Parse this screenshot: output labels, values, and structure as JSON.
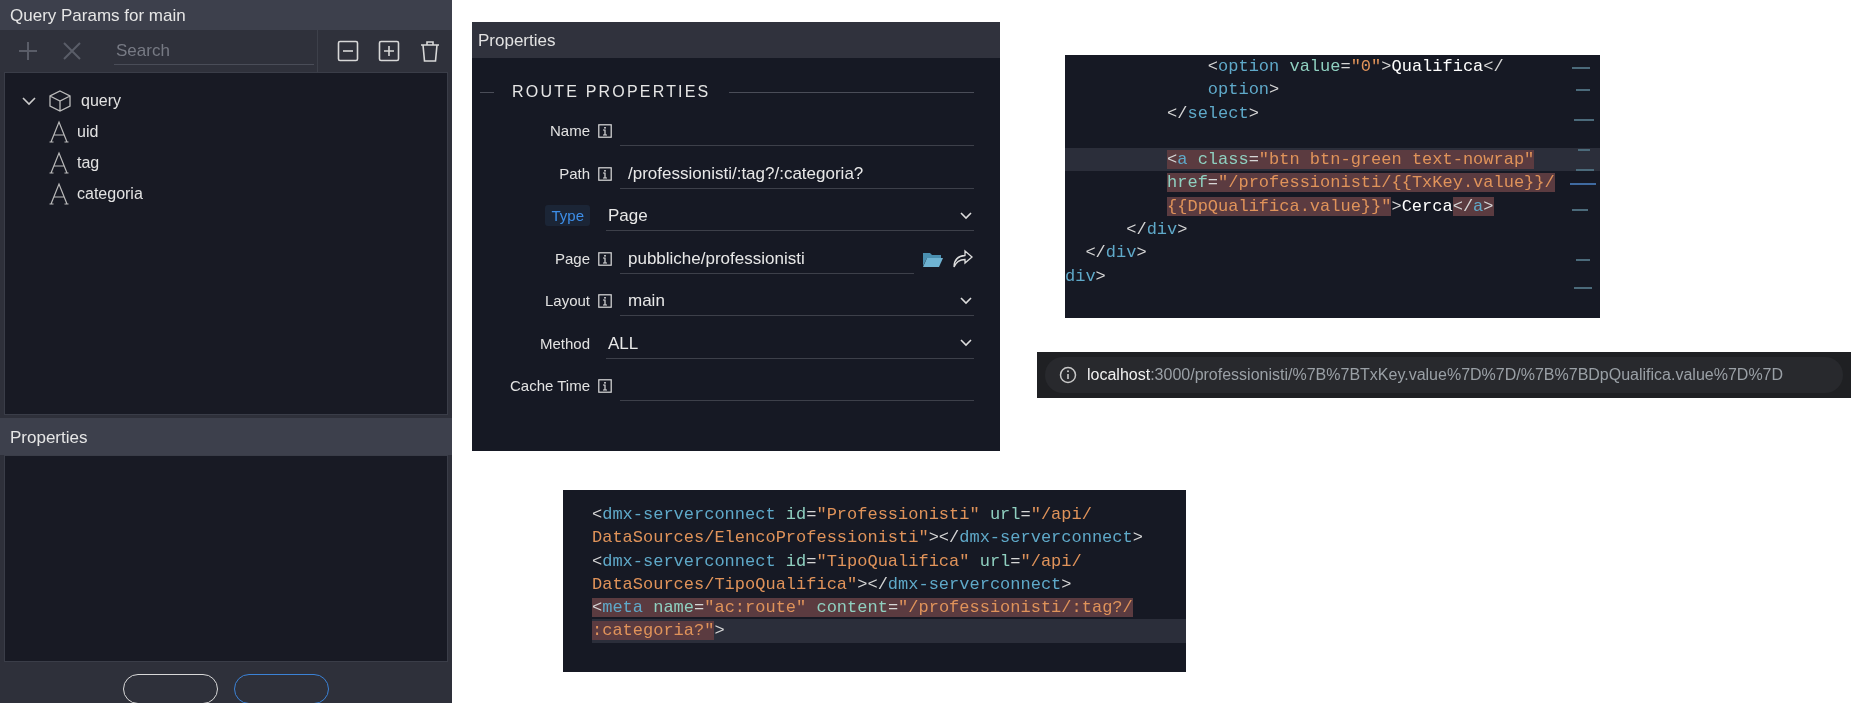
{
  "query_params_panel": {
    "title": "Query Params for main",
    "toolbar": [
      {
        "kind": "add",
        "disabled": true
      },
      {
        "kind": "remove",
        "disabled": true
      },
      {
        "kind": "collapse",
        "disabled": false
      },
      {
        "kind": "expand",
        "disabled": false
      },
      {
        "kind": "delete",
        "disabled": false
      }
    ],
    "search": {
      "placeholder": "Search"
    },
    "tree": [
      {
        "label": "query",
        "kind": "object",
        "expanded": true,
        "children": [
          {
            "label": "uid",
            "kind": "text"
          },
          {
            "label": "tag",
            "kind": "text"
          },
          {
            "label": "categoria",
            "kind": "text"
          }
        ]
      }
    ],
    "properties_title": "Properties",
    "footer_buttons": [
      {
        "kind": "plain"
      },
      {
        "kind": "primary"
      }
    ]
  },
  "route_panel": {
    "title": "Properties",
    "section": "ROUTE PROPERTIES",
    "rows": [
      {
        "label": "Name",
        "kind": "input",
        "info": true,
        "highlighted": false
      },
      {
        "label": "Path",
        "kind": "input",
        "info": true,
        "value": "/professionisti/:tag?/:categoria?",
        "highlighted": false
      },
      {
        "label": "Type",
        "kind": "select",
        "info": false,
        "value": "Page",
        "highlighted": true
      },
      {
        "label": "Page",
        "kind": "page",
        "info": true,
        "value": "pubbliche/professionisti",
        "highlighted": false
      },
      {
        "label": "Layout",
        "kind": "select",
        "info": true,
        "value": "main",
        "highlighted": false
      },
      {
        "label": "Method",
        "kind": "select",
        "info": false,
        "value": "ALL",
        "highlighted": false
      },
      {
        "label": "Cache Time",
        "kind": "input",
        "info": true,
        "highlighted": false
      }
    ]
  },
  "code_top": {
    "lines": [
      {
        "current": false,
        "tokens": [
          {
            "kind": "punct",
            "text": "              <",
            "marked": false
          },
          {
            "kind": "tag",
            "text": "option",
            "marked": false
          },
          {
            "kind": "attr",
            "text": " value",
            "marked": false
          },
          {
            "kind": "punct",
            "text": "=",
            "marked": false
          },
          {
            "kind": "str",
            "text": "\"0\"",
            "marked": false
          },
          {
            "kind": "punct",
            "text": ">",
            "marked": false
          },
          {
            "kind": "text",
            "text": "Qualifica",
            "marked": false
          },
          {
            "kind": "punct",
            "text": "</",
            "marked": false
          }
        ]
      },
      {
        "current": false,
        "tokens": [
          {
            "kind": "tag",
            "text": "              option",
            "marked": false
          },
          {
            "kind": "punct",
            "text": ">",
            "marked": false
          }
        ]
      },
      {
        "current": false,
        "tokens": [
          {
            "kind": "punct",
            "text": "          </",
            "marked": false
          },
          {
            "kind": "tag",
            "text": "select",
            "marked": false
          },
          {
            "kind": "punct",
            "text": ">",
            "marked": false
          }
        ]
      },
      {
        "current": false
      },
      {
        "current": true,
        "tokens": [
          {
            "kind": "punct",
            "text": "          <",
            "marked": true
          },
          {
            "kind": "tag",
            "text": "a",
            "marked": true
          },
          {
            "kind": "attr",
            "text": " class",
            "marked": true
          },
          {
            "kind": "punct",
            "text": "=",
            "marked": true
          },
          {
            "kind": "str",
            "text": "\"btn btn-green text-nowrap\"",
            "marked": true
          }
        ]
      },
      {
        "current": false,
        "tokens": [
          {
            "kind": "attr",
            "text": "          href",
            "marked": true
          },
          {
            "kind": "punct",
            "text": "=",
            "marked": true
          },
          {
            "kind": "str",
            "text": "\"/professionisti/{{TxKey.value}}/",
            "marked": true
          }
        ]
      },
      {
        "current": false,
        "tokens": [
          {
            "kind": "str",
            "text": "          {{DpQualifica.value}}\"",
            "marked": true
          },
          {
            "kind": "punct",
            "text": ">",
            "marked": false
          },
          {
            "kind": "text",
            "text": "Cerca",
            "marked": false
          },
          {
            "kind": "punct",
            "text": "</",
            "marked": true
          },
          {
            "kind": "tag",
            "text": "a",
            "marked": true
          },
          {
            "kind": "punct",
            "text": ">",
            "marked": true
          }
        ]
      },
      {
        "current": false,
        "tokens": [
          {
            "kind": "punct",
            "text": "      </",
            "marked": false
          },
          {
            "kind": "tag",
            "text": "div",
            "marked": false
          },
          {
            "kind": "punct",
            "text": ">",
            "marked": false
          }
        ]
      },
      {
        "current": false,
        "tokens": [
          {
            "kind": "punct",
            "text": "  </",
            "marked": false
          },
          {
            "kind": "tag",
            "text": "div",
            "marked": false
          },
          {
            "kind": "punct",
            "text": ">",
            "marked": false
          }
        ]
      },
      {
        "current": false,
        "tokens": [
          {
            "kind": "tag",
            "text": "div",
            "marked": false
          },
          {
            "kind": "punct",
            "text": ">",
            "marked": false
          }
        ]
      }
    ]
  },
  "address_bar": {
    "host": "localhost",
    "path": ":3000/professionisti/%7B%7BTxKey.value%7D%7D/%7B%7BDpQualifica.value%7D%7D"
  },
  "code_bottom": {
    "lines": [
      {
        "current": false,
        "tokens": [
          {
            "kind": "punct",
            "text": "<",
            "marked": false
          },
          {
            "kind": "tag",
            "text": "dmx-serverconnect",
            "marked": false
          },
          {
            "kind": "attr",
            "text": " id",
            "marked": false
          },
          {
            "kind": "punct",
            "text": "=",
            "marked": false
          },
          {
            "kind": "str",
            "text": "\"Professionisti\"",
            "marked": false
          },
          {
            "kind": "attr",
            "text": " url",
            "marked": false
          },
          {
            "kind": "punct",
            "text": "=",
            "marked": false
          },
          {
            "kind": "str",
            "text": "\"/api/",
            "marked": false
          }
        ]
      },
      {
        "current": false,
        "tokens": [
          {
            "kind": "str",
            "text": "DataSources/ElencoProfessionisti\"",
            "marked": false
          },
          {
            "kind": "punct",
            "text": "></",
            "marked": false
          },
          {
            "kind": "tag",
            "text": "dmx-serverconnect",
            "marked": false
          },
          {
            "kind": "punct",
            "text": ">",
            "marked": false
          }
        ]
      },
      {
        "current": false,
        "tokens": [
          {
            "kind": "punct",
            "text": "<",
            "marked": false
          },
          {
            "kind": "tag",
            "text": "dmx-serverconnect",
            "marked": false
          },
          {
            "kind": "attr",
            "text": " id",
            "marked": false
          },
          {
            "kind": "punct",
            "text": "=",
            "marked": false
          },
          {
            "kind": "str",
            "text": "\"TipoQualifica\"",
            "marked": false
          },
          {
            "kind": "attr",
            "text": " url",
            "marked": false
          },
          {
            "kind": "punct",
            "text": "=",
            "marked": false
          },
          {
            "kind": "str",
            "text": "\"/api/",
            "marked": false
          }
        ]
      },
      {
        "current": false,
        "tokens": [
          {
            "kind": "str",
            "text": "DataSources/TipoQualifica\"",
            "marked": false
          },
          {
            "kind": "punct",
            "text": "></",
            "marked": false
          },
          {
            "kind": "tag",
            "text": "dmx-serverconnect",
            "marked": false
          },
          {
            "kind": "punct",
            "text": ">",
            "marked": false
          }
        ]
      },
      {
        "current": false,
        "tokens": [
          {
            "kind": "punct",
            "text": "<",
            "marked": true
          },
          {
            "kind": "tag",
            "text": "meta",
            "marked": true
          },
          {
            "kind": "attr",
            "text": " name",
            "marked": true
          },
          {
            "kind": "punct",
            "text": "=",
            "marked": true
          },
          {
            "kind": "str",
            "text": "\"ac:route\"",
            "marked": true
          },
          {
            "kind": "attr",
            "text": " content",
            "marked": true
          },
          {
            "kind": "punct",
            "text": "=",
            "marked": true
          },
          {
            "kind": "str",
            "text": "\"/professionisti/:tag?/",
            "marked": true
          }
        ]
      },
      {
        "current": true,
        "tokens": [
          {
            "kind": "str",
            "text": ":categoria?\"",
            "marked": true
          },
          {
            "kind": "punct",
            "text": ">",
            "marked": false
          }
        ]
      }
    ]
  }
}
